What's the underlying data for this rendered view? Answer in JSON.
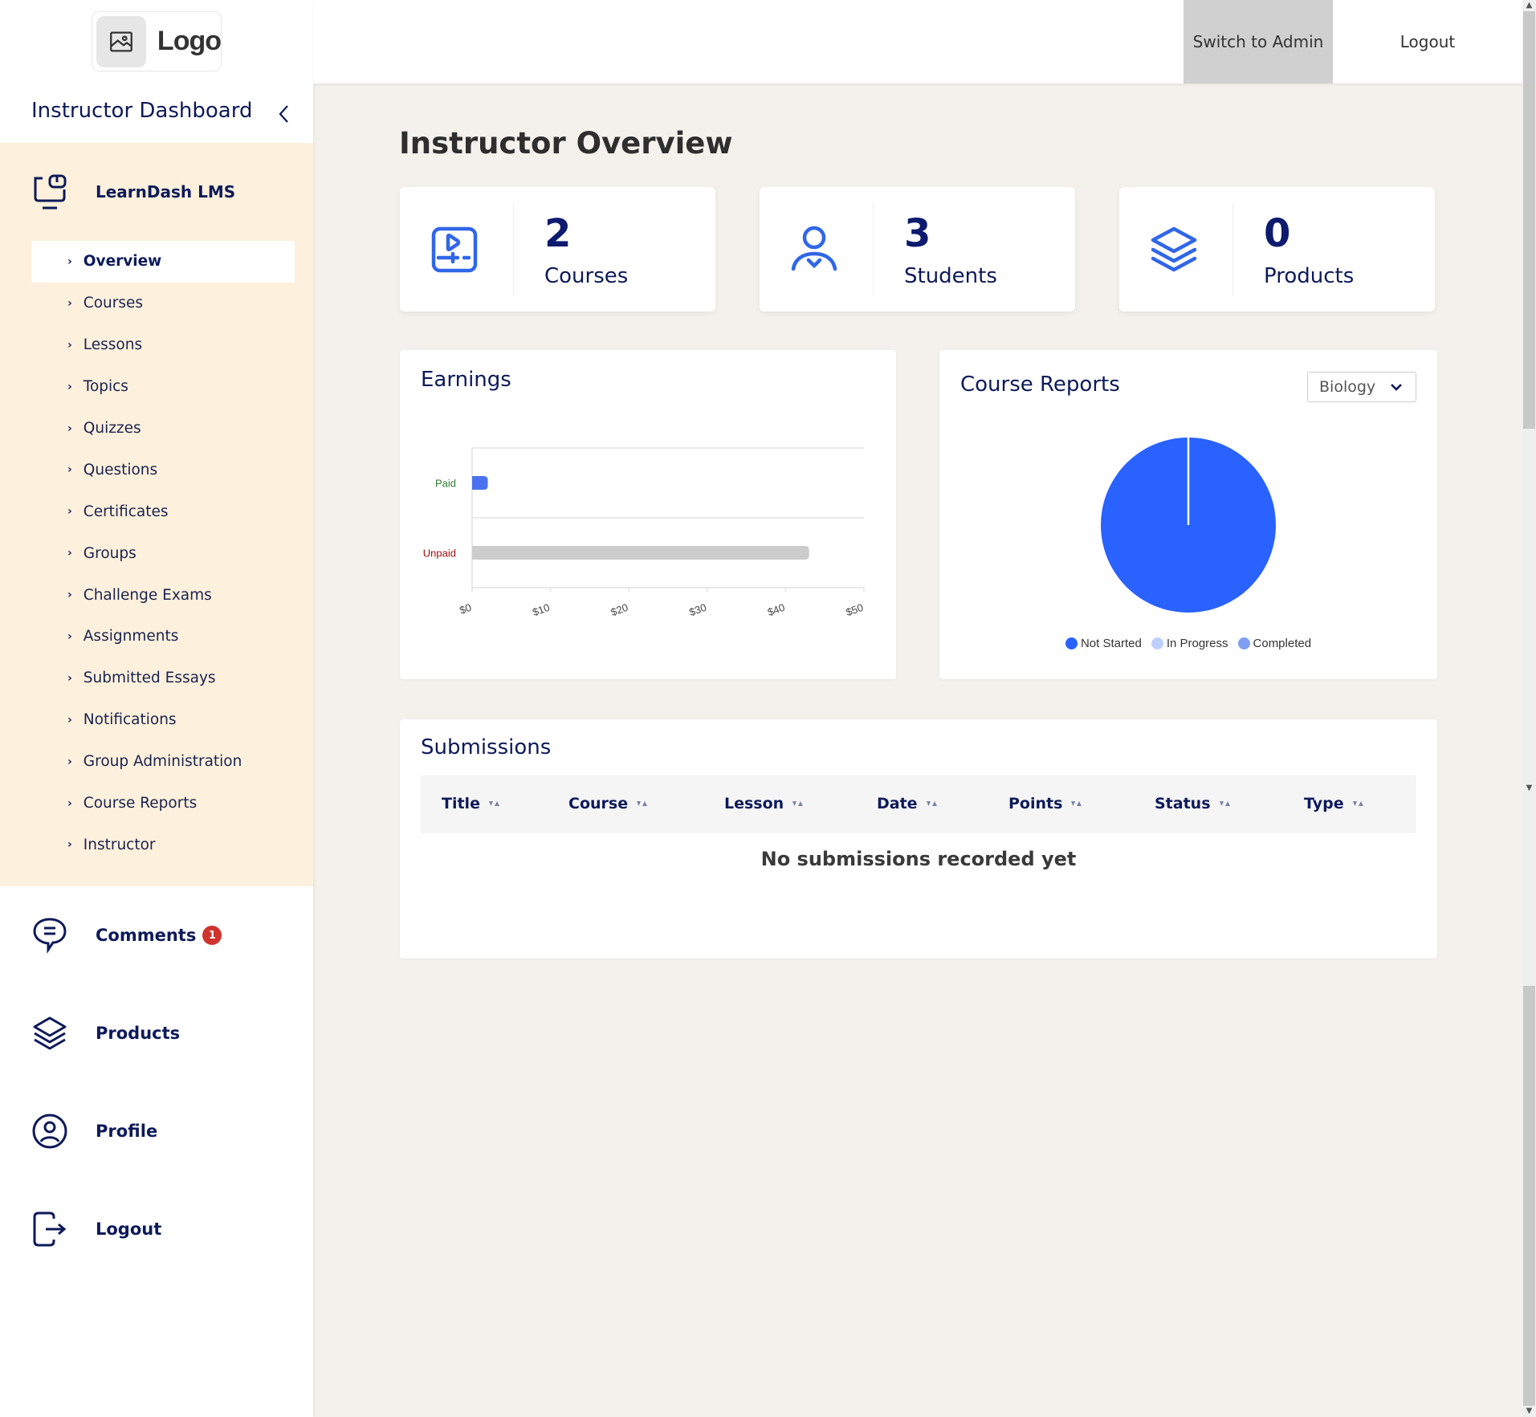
{
  "sidebar": {
    "logo_text": "Logo",
    "dashboard_title": "Instructor Dashboard",
    "lms_section": {
      "label": "LearnDash LMS",
      "items": [
        {
          "label": "Overview",
          "active": true
        },
        {
          "label": "Courses"
        },
        {
          "label": "Lessons"
        },
        {
          "label": "Topics"
        },
        {
          "label": "Quizzes"
        },
        {
          "label": "Questions"
        },
        {
          "label": "Certificates"
        },
        {
          "label": "Groups"
        },
        {
          "label": "Challenge Exams"
        },
        {
          "label": "Assignments"
        },
        {
          "label": "Submitted Essays"
        },
        {
          "label": "Notifications"
        },
        {
          "label": "Group Administration"
        },
        {
          "label": "Course Reports"
        },
        {
          "label": "Instructor"
        }
      ]
    },
    "nav": {
      "comments": {
        "label": "Comments",
        "badge": "1"
      },
      "products": {
        "label": "Products"
      },
      "profile": {
        "label": "Profile"
      },
      "logout": {
        "label": "Logout"
      }
    }
  },
  "topbar": {
    "switch_admin": "Switch to Admin",
    "logout": "Logout"
  },
  "main": {
    "page_title": "Instructor Overview",
    "stats": [
      {
        "value": "2",
        "label": "Courses",
        "icon": "course-video-icon"
      },
      {
        "value": "3",
        "label": "Students",
        "icon": "student-icon"
      },
      {
        "value": "0",
        "label": "Products",
        "icon": "layers-icon"
      }
    ],
    "earnings": {
      "title": "Earnings"
    },
    "course_reports": {
      "title": "Course Reports",
      "selected_course": "Biology"
    },
    "submissions": {
      "title": "Submissions",
      "columns": [
        "Title",
        "Course",
        "Lesson",
        "Date",
        "Points",
        "Status",
        "Type"
      ],
      "empty_message": "No submissions recorded yet"
    }
  },
  "colors": {
    "accent": "#2962ff",
    "navy": "#0d1a5a",
    "sidebar_section_bg": "#fdf0dc",
    "page_bg": "#f4f1ec",
    "badge": "#d0342c"
  },
  "chart_data": [
    {
      "type": "bar",
      "orientation": "horizontal",
      "title": "Earnings",
      "categories": [
        "Paid",
        "Unpaid"
      ],
      "values": [
        2,
        43
      ],
      "category_colors": {
        "Paid": "#2e7d32",
        "Unpaid": "#a01010"
      },
      "bar_colors": [
        "#4a72f0",
        "#cccccc"
      ],
      "xlim": [
        0,
        50
      ],
      "xticks": [
        "$0",
        "$10",
        "$20",
        "$30",
        "$40",
        "$50"
      ],
      "xlabel": "",
      "ylabel": "",
      "grid": true
    },
    {
      "type": "pie",
      "title": "Course Reports",
      "labels": [
        "Not Started",
        "In Progress",
        "Completed"
      ],
      "values": [
        100,
        0,
        0
      ],
      "colors": [
        "#2962ff",
        "#bcd0fb",
        "#7d9ef2"
      ],
      "legend": "bottom"
    }
  ]
}
